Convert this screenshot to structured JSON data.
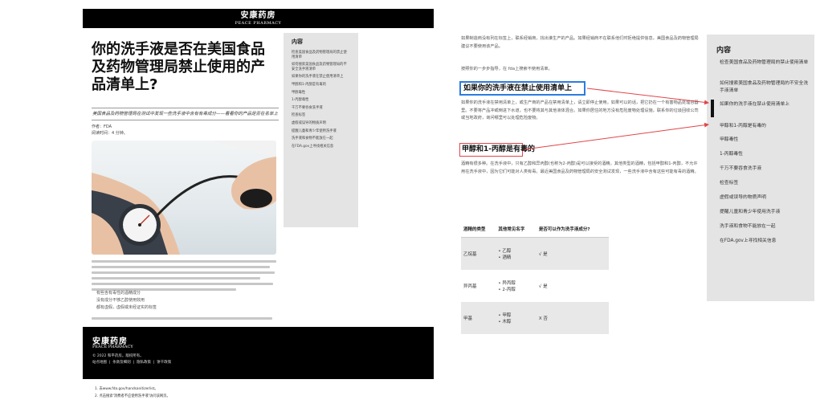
{
  "brand": {
    "name_cn": "安康药房",
    "name_en": "PEACE PHARMACY"
  },
  "article": {
    "title": "你的洗手液是否在美国食品及药物管理局禁止使用的产品清单上?",
    "subtitle": "美国食品及药物管理局在测试中发现一些洗手液中含有有毒成分——看看你的产品是否在名单上",
    "author": "作者：FDA",
    "read_time": "阅读时间：4 分钟。",
    "bullets": [
      "有些含有毒性的酒精成分",
      "没有成分不够乙醇使用效用",
      "都有虚假，虚假或未经证实的标签"
    ]
  },
  "toc": {
    "title": "内容",
    "left_items": [
      "检查美国食品及药物管理局的禁止使用清单",
      "如何搜索美国食品及药物管理局的不安全洗手液清单",
      "如果你的洗手液在禁止使用清单上",
      "甲醇和1-丙醇是有毒的",
      "甲醇毒性",
      "1-丙醇毒性",
      "千万不要吞食洗手液",
      "检查标签",
      "虚假或误导的物质声明",
      "提醒儿童和青少年使用洗手液",
      "洗手液和食物不能放在一起",
      "在FDA.gov上寻找相关信息"
    ],
    "right_items": [
      "检查美国食品及药物管理局的禁止使用清单",
      "如何搜索美国食品及药物管理局的不安全洗手液清单",
      "如果你的洗手液在禁止使用清单上",
      "甲醇和1-丙醇是有毒的",
      "甲醇毒性",
      "1-丙醇毒性",
      "千万不要吞食洗手液",
      "检查标签",
      "虚假或误导的物质声明",
      "提醒儿童和青少年使用洗手液",
      "洗手液和食物不能放在一起",
      "在FDA.gov上寻找相关信息"
    ]
  },
  "footer": {
    "copyright": "© 2022 和平药房。版权所有。",
    "links": [
      "站点地图",
      "条款及细则",
      "隐私政策",
      "饼干政策"
    ]
  },
  "notes": [
    "1. 去www.fda.gov/handsanitizerlist。",
    "2. 点击搜索'消费者不应使用洗手液'访问该网页。"
  ],
  "detail": {
    "para_top": "如果制造商没有列在标签上，联系经销商，找出谁生产的产品。如果经销商不在联系他们时拒绝提供信息，美国食品及药物管理局建议不要使用该产品。",
    "para_step": "按照你的一步步指导，在 fda上搜索不使用清单。",
    "heading1": "如果你的洗手液在禁止使用清单上",
    "para_mid": "如果你的洗手液在禁用清单上，或生产商的产品在禁用清单上，请立即停止使用。如果可以的话，把它扔在一个有害物品处理容器里。不要将产品冲或倒进下水道，也不要将其与其他液体混合。如果你居住的地方没有危险废物处理设施，联系你的垃圾回收公司或当地政府，询问哪里可以处理危险废物。",
    "heading2": "甲醇和1-丙醇是有毒的",
    "para_alc": "酒精有很多种。在洗手液中，只有乙醇和异丙醇(也称为2-丙醇)是可以接受的酒精。其他类型的酒精，包括甲醇和1-丙醇，不允许用在洗手液中，因为它们可能对人类有毒。最近美国食品及药物管理局的安全测试发现，一些洗手液中含有这些可能有毒的酒精。",
    "table": {
      "headers": [
        "酒精的类型",
        "其他常见名字",
        "是否可以作为洗手液成分?"
      ],
      "rows": [
        {
          "type": "乙烷基",
          "names": [
            "乙醇",
            "酒精"
          ],
          "ok": "√ 是"
        },
        {
          "type": "异丙基",
          "names": [
            "异丙醇",
            "2-丙醇"
          ],
          "ok": "√ 是"
        },
        {
          "type": "甲基",
          "names": [
            "甲醇",
            "木醇"
          ],
          "ok": "X 否"
        }
      ]
    }
  },
  "colors": {
    "highlight_blue": "#2d7be0",
    "highlight_red": "#e0464b",
    "toc_bg": "#e4e4e4"
  }
}
